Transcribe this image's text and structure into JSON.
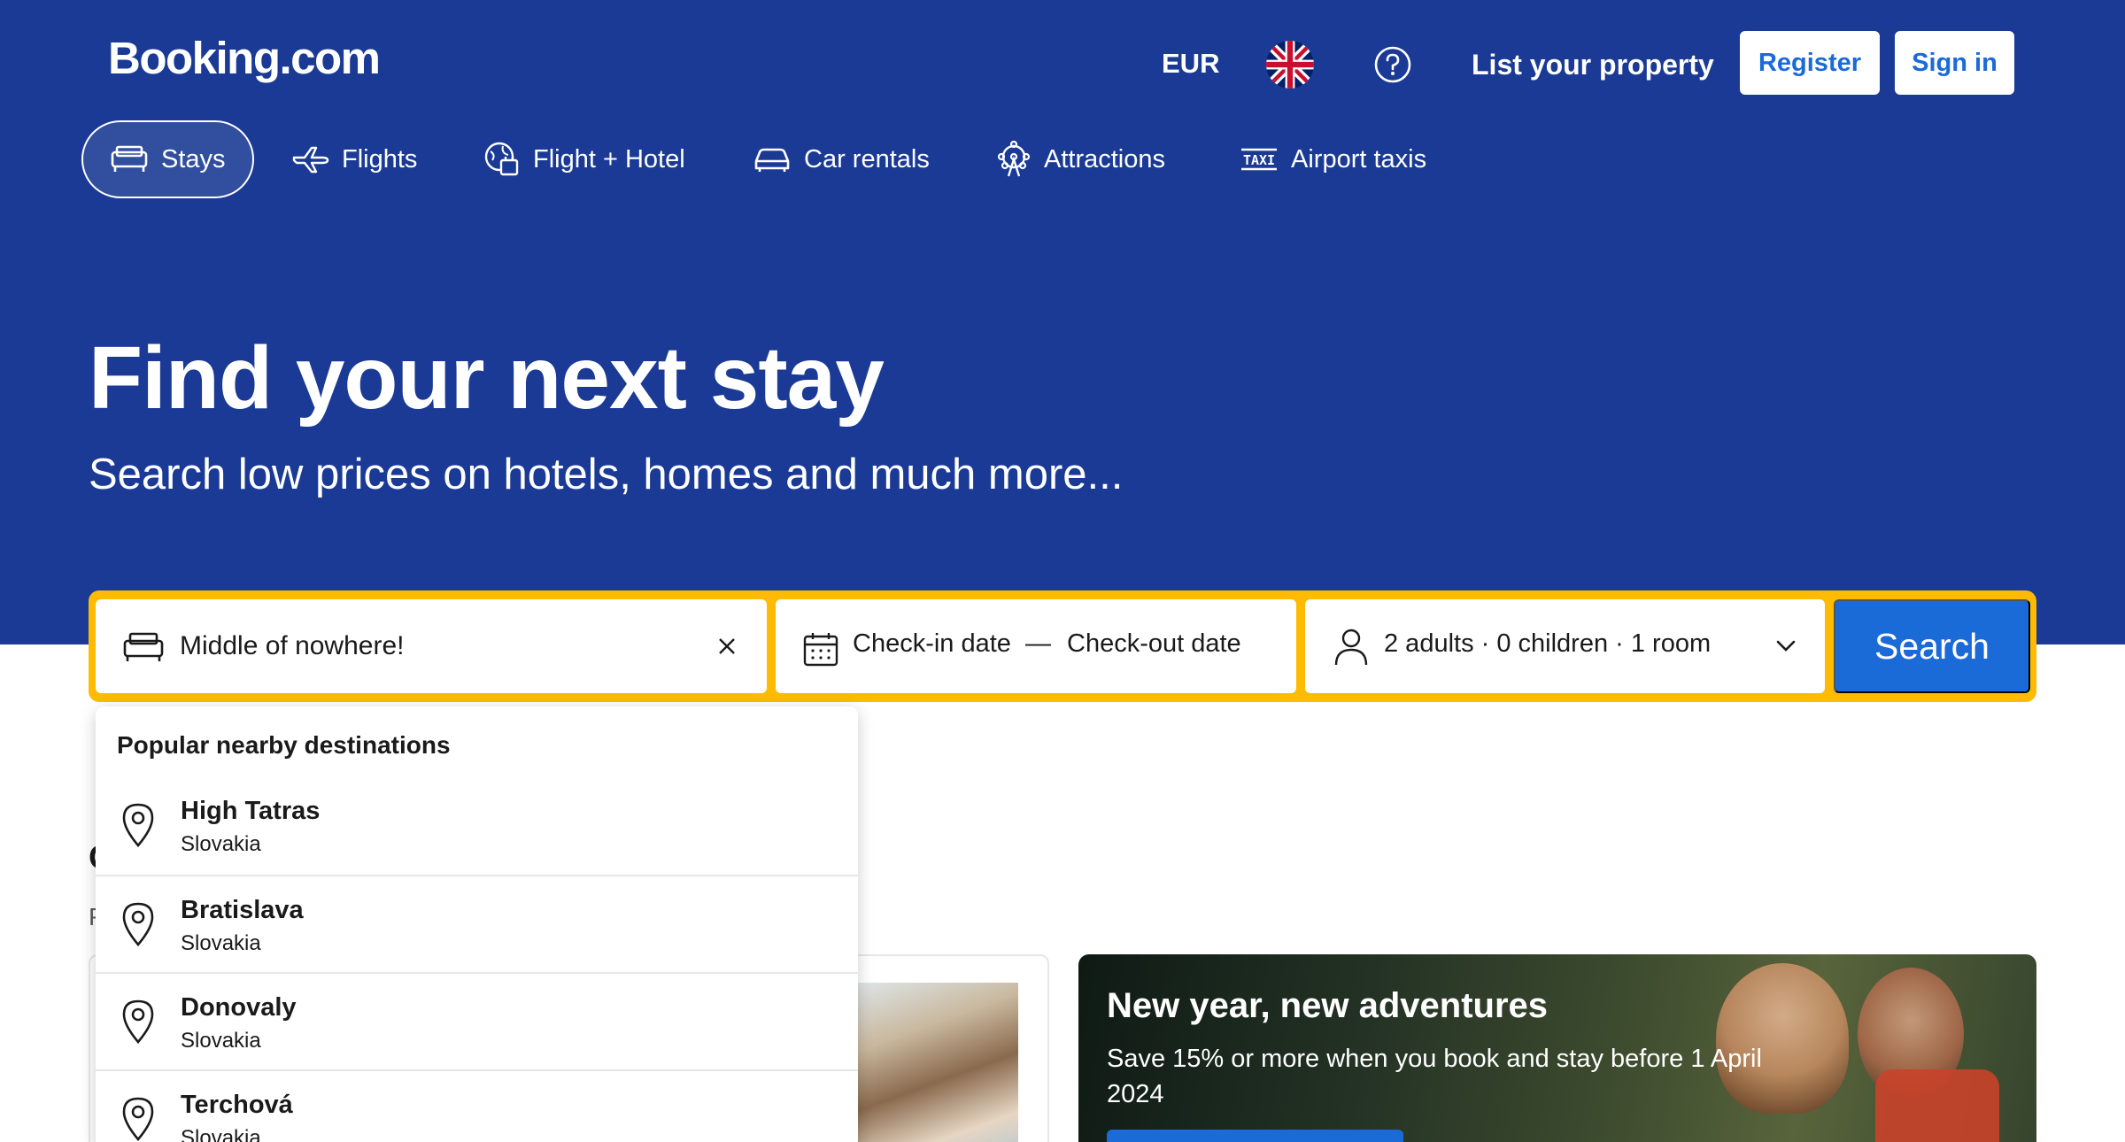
{
  "header": {
    "logo": "Booking.com",
    "currency": "EUR",
    "language_flag_icon": "uk-flag-icon",
    "help_icon": "question-circle-icon",
    "list_property": "List your property",
    "register": "Register",
    "sign_in": "Sign in"
  },
  "nav": {
    "items": [
      {
        "label": "Stays",
        "icon": "bed-icon",
        "active": true
      },
      {
        "label": "Flights",
        "icon": "plane-icon"
      },
      {
        "label": "Flight + Hotel",
        "icon": "flight-hotel-icon"
      },
      {
        "label": "Car rentals",
        "icon": "car-icon"
      },
      {
        "label": "Attractions",
        "icon": "ferris-wheel-icon"
      },
      {
        "label": "Airport taxis",
        "icon": "taxi-icon"
      }
    ]
  },
  "hero": {
    "headline": "Find your next stay",
    "subline": "Search low prices on hotels, homes and much more..."
  },
  "search": {
    "destination_value": "Middle of nowhere!",
    "checkin_label": "Check-in date",
    "date_separator": "—",
    "checkout_label": "Check-out date",
    "guests": "2 adults · 0 children · 1 room",
    "button": "Search"
  },
  "dropdown": {
    "title": "Popular nearby destinations",
    "items": [
      {
        "name": "High Tatras",
        "country": "Slovakia"
      },
      {
        "name": "Bratislava",
        "country": "Slovakia"
      },
      {
        "name": "Donovaly",
        "country": "Slovakia"
      },
      {
        "name": "Terchová",
        "country": "Slovakia"
      }
    ]
  },
  "below": {
    "peek_heading_char": "O",
    "peek_sub_char": "P",
    "promo_title": "New year, new adventures",
    "promo_text": "Save 15% or more when you book and stay before 1 April 2024"
  },
  "colors": {
    "brand_blue": "#1a3a95",
    "accent_blue": "#1a6ad8",
    "search_border": "#febb02"
  }
}
